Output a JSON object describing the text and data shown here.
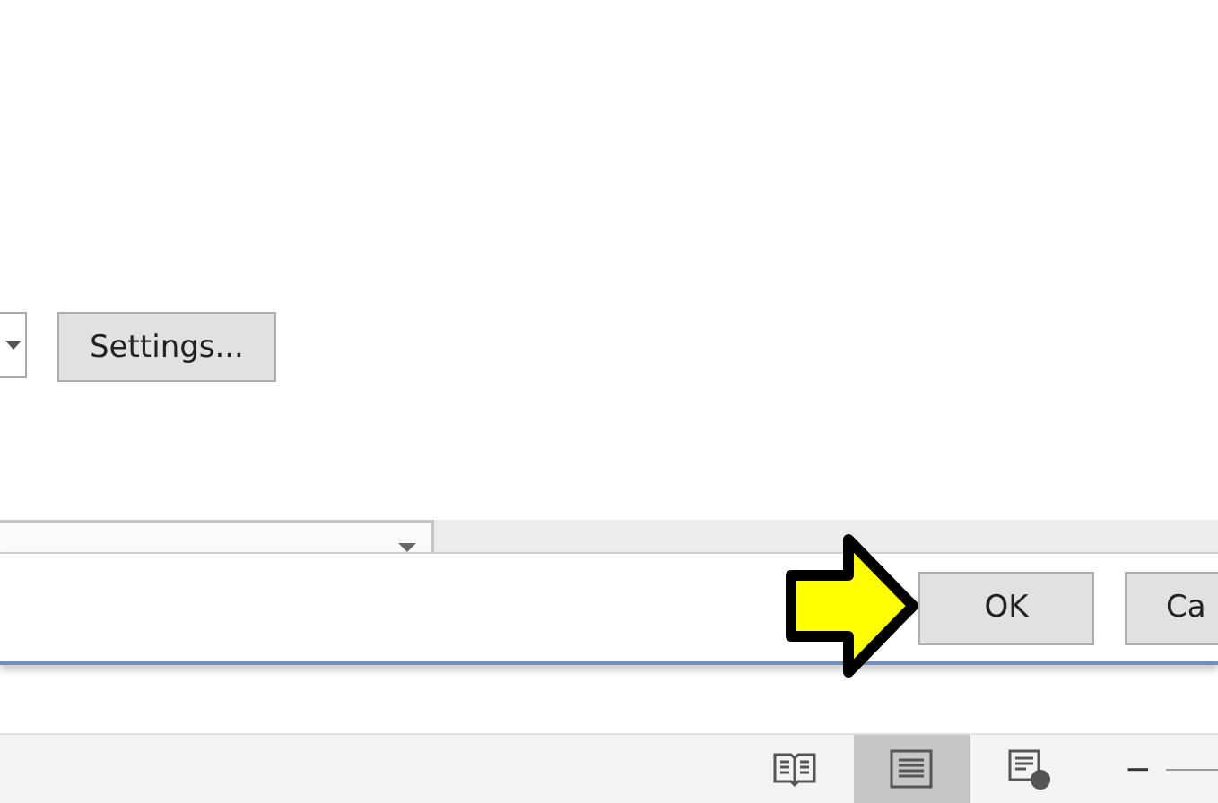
{
  "settings_button": {
    "label": "Settings..."
  },
  "dialog_buttons": [
    {
      "label": "OK"
    },
    {
      "label": "Ca"
    }
  ],
  "view_buttons": [
    {
      "kind": "read",
      "selected": false
    },
    {
      "kind": "print",
      "selected": true
    },
    {
      "kind": "web",
      "selected": false
    }
  ],
  "zoom": {
    "label": "−"
  }
}
